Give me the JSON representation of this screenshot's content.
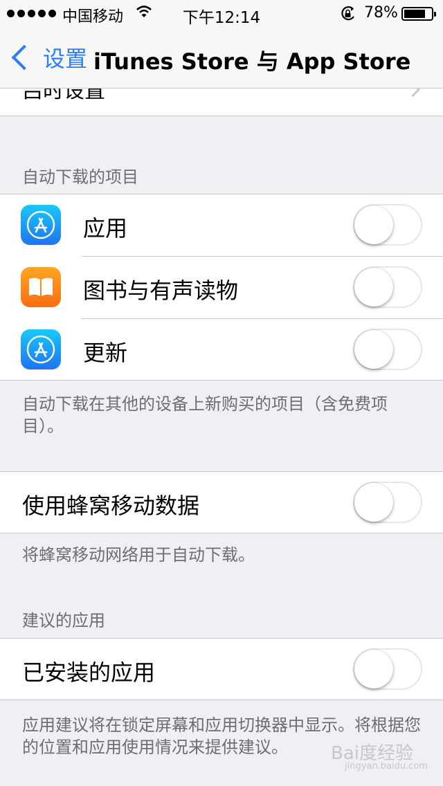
{
  "status_bar": {
    "carrier": "中国移动",
    "time": "下午12:14",
    "battery_percent": "78%",
    "battery_level": 0.78,
    "signal_icon": "signal-dots-icon",
    "wifi_icon": "wifi-icon",
    "lock_icon": "rotation-lock-icon"
  },
  "nav": {
    "back_label": "设置",
    "title": "iTunes Store 与 App Store"
  },
  "cut_row": {
    "label": "吕时设置"
  },
  "auto_download": {
    "header": "自动下载的项目",
    "items": [
      {
        "label": "应用",
        "icon": "app-store-icon",
        "on": false
      },
      {
        "label": "图书与有声读物",
        "icon": "books-icon",
        "on": false
      },
      {
        "label": "更新",
        "icon": "app-store-icon",
        "on": false
      }
    ],
    "footer": "自动下载在其他的设备上新购买的项目（含免费项目）。"
  },
  "cellular": {
    "label": "使用蜂窝移动数据",
    "on": false,
    "footer": "将蜂窝移动网络用于自动下载。"
  },
  "suggested_apps": {
    "header": "建议的应用",
    "label": "已安装的应用",
    "on": false,
    "footer": "应用建议将在锁定屏幕和应用切换器中显示。将根据您的位置和应用使用情况来提供建议。"
  },
  "watermark": {
    "text": "Bai度经验",
    "sub": "jingyan.baidu.com"
  },
  "colors": {
    "accent": "#2b7ef7",
    "background": "#efeff4",
    "separator": "#c8c7cc"
  }
}
